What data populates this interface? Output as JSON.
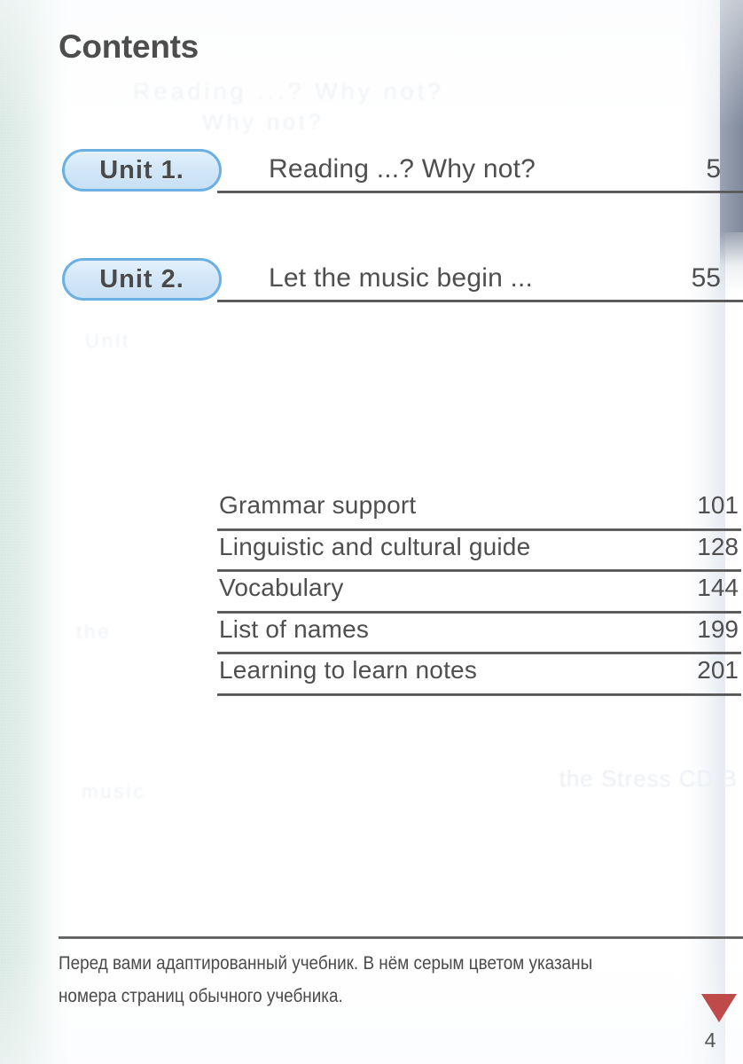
{
  "page": {
    "title": "Contents",
    "folio": "4"
  },
  "units": [
    {
      "badge": "Unit  1.",
      "title": "Reading  ...?  Why  not?",
      "page": "5"
    },
    {
      "badge": "Unit  2.",
      "title": "Let  the  music  begin  ...",
      "page": "55"
    }
  ],
  "backmatter": [
    {
      "label": "Grammar  support",
      "page": "101"
    },
    {
      "label": "Linguistic  and  cultural  guide",
      "page": "128"
    },
    {
      "label": "Vocabulary",
      "page": "144"
    },
    {
      "label": "List  of  names",
      "page": "199"
    },
    {
      "label": "Learning  to  learn  notes",
      "page": "201"
    }
  ],
  "footer": {
    "note": "Перед вами адаптированный учебник. В нём серым цветом указаны\nномера страниц обычного учебника."
  },
  "ghost_text": {
    "line1": "Reading ...? Why not?",
    "line2": "Why  not?",
    "line3": "Unit",
    "line4": "the",
    "line5": "music",
    "vertical": "the\nStress\nCD\nB"
  },
  "colors": {
    "badge_fill": "#d3e7f8",
    "badge_border": "#6bb0e2",
    "text": "#4f4f4f",
    "rule": "#4d4d4d",
    "spine_green": "#dcebe5",
    "edge_grey": "#8e98a8",
    "marker_red": "#bf4a4a"
  }
}
